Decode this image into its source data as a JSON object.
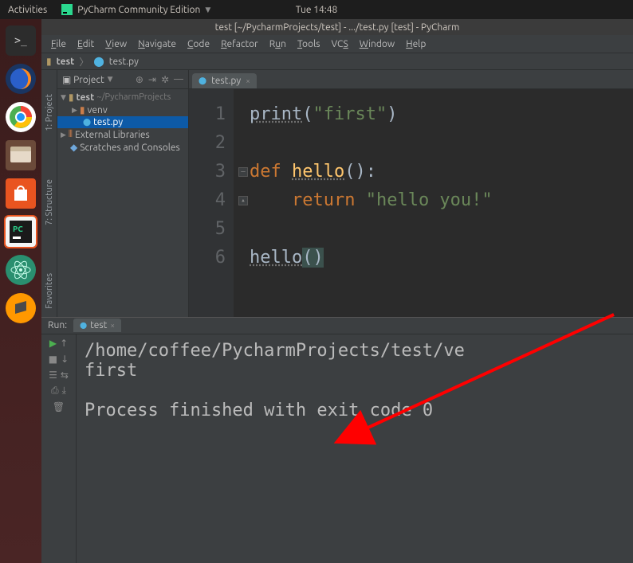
{
  "gnome": {
    "activities": "Activities",
    "app_indicator": "PyCharm Community Edition",
    "clock": "Tue 14:48"
  },
  "window_title": "test [~/PycharmProjects/test] - .../test.py [test] - PyCharm",
  "menu": [
    "File",
    "Edit",
    "View",
    "Navigate",
    "Code",
    "Refactor",
    "Run",
    "Tools",
    "VCS",
    "Window",
    "Help"
  ],
  "breadcrumb": {
    "root": "test",
    "file": "test.py"
  },
  "project_panel": {
    "title": "Project",
    "root": {
      "name": "test",
      "path": "~/PycharmProjects"
    },
    "venv": "venv",
    "file": "test.py",
    "ext_libs": "External Libraries",
    "scratches": "Scratches and Consoles"
  },
  "editor": {
    "tab": "test.py",
    "lines": [
      "1",
      "2",
      "3",
      "4",
      "5",
      "6"
    ],
    "code": {
      "l1_print": "print",
      "l1_str": "\"first\"",
      "l3_def": "def",
      "l3_fn": "hello",
      "l4_return": "return",
      "l4_str": "\"hello you!\"",
      "l6_call": "hello"
    }
  },
  "run": {
    "title": "Run:",
    "config": "test",
    "output_path": "/home/coffee/PycharmProjects/test/ve",
    "output_l2": "first",
    "output_l4": "Process finished with exit code 0"
  },
  "sidebars": {
    "project": "1: Project",
    "structure": "7: Structure",
    "favorites": "Favorites"
  }
}
